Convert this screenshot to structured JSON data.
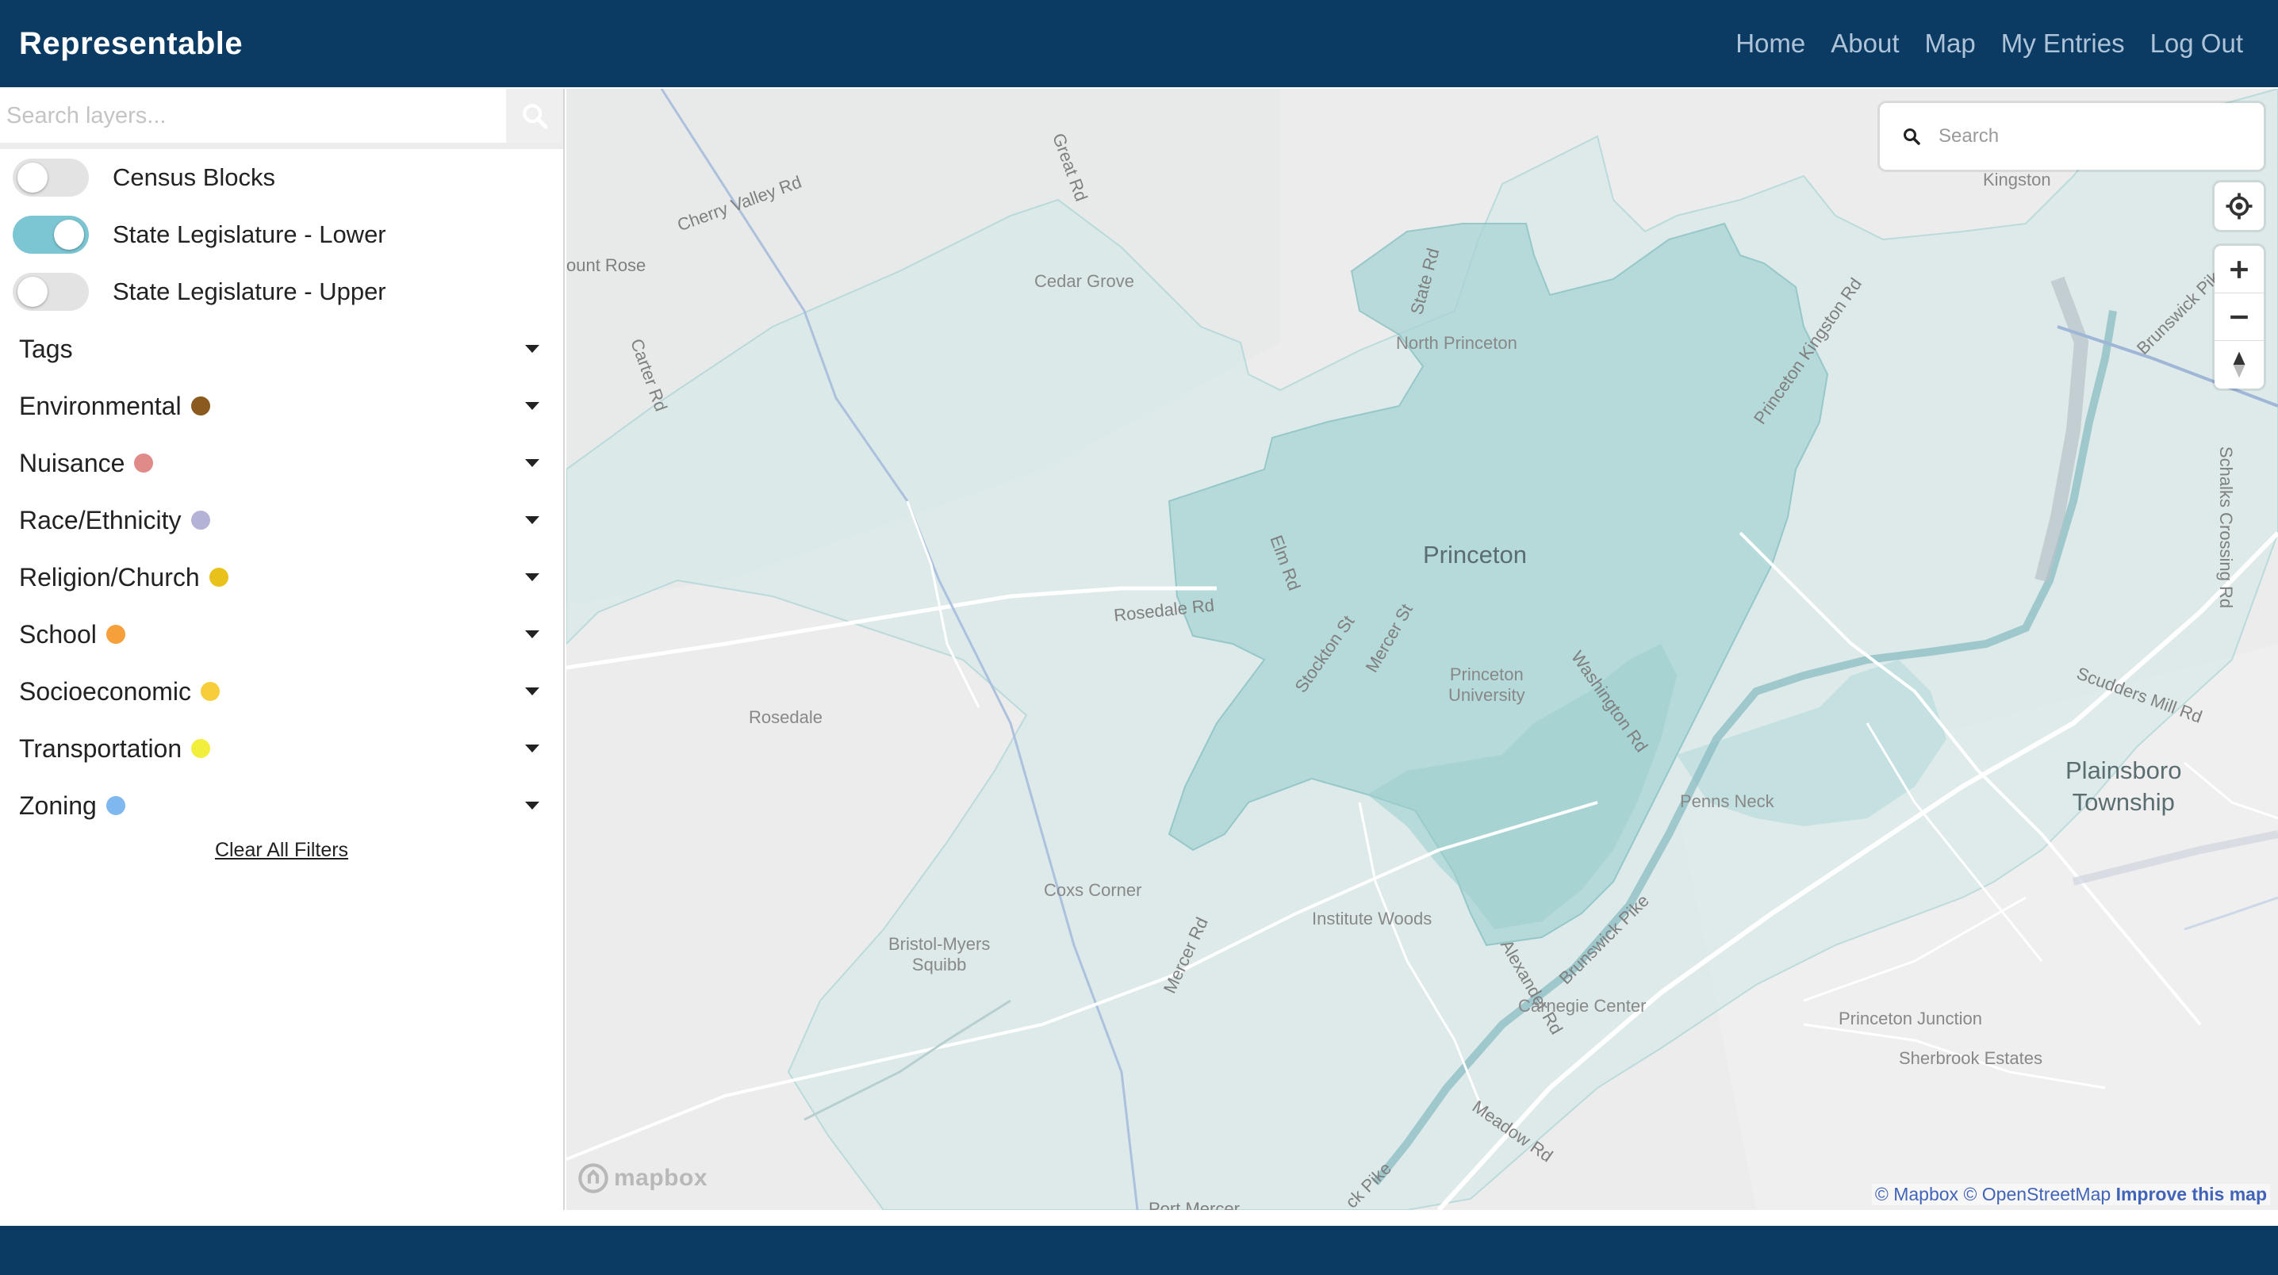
{
  "app": {
    "brand": "Representable"
  },
  "nav": {
    "links": [
      {
        "label": "Home"
      },
      {
        "label": "About"
      },
      {
        "label": "Map"
      },
      {
        "label": "My Entries"
      },
      {
        "label": "Log Out"
      }
    ]
  },
  "sidebar": {
    "search_placeholder": "Search layers...",
    "layers": [
      {
        "label": "Census Blocks",
        "enabled": false
      },
      {
        "label": "State Legislature - Lower",
        "enabled": true
      },
      {
        "label": "State Legislature - Upper",
        "enabled": false
      }
    ],
    "tags_label": "Tags",
    "filters": [
      {
        "label": "Environmental",
        "color": "#8b5a1e"
      },
      {
        "label": "Nuisance",
        "color": "#e08a8a"
      },
      {
        "label": "Race/Ethnicity",
        "color": "#b4b2d6"
      },
      {
        "label": "Religion/Church",
        "color": "#e8c21a"
      },
      {
        "label": "School",
        "color": "#f5a03a"
      },
      {
        "label": "Socioeconomic",
        "color": "#f7cd3c"
      },
      {
        "label": "Transportation",
        "color": "#f2ef3c"
      },
      {
        "label": "Zoning",
        "color": "#7fb8ef"
      }
    ],
    "clear_label": "Clear All Filters"
  },
  "map": {
    "search_placeholder": "Search",
    "labels": {
      "cherry_valley": "Cherry Valley Rd",
      "great_rd": "Great Rd",
      "mount_rose": "ount Rose",
      "cedar_grove": "Cedar Grove",
      "carter_rd": "Carter Rd",
      "state_rd": "State Rd",
      "north_princeton": "North Princeton",
      "kingston": "Kingston",
      "princeton_kingston": "Princeton Kingston Rd",
      "brunswick_pike_top": "Brunswick Pik",
      "schalks": "Schalks Crossing Rd",
      "princeton": "Princeton",
      "elm_rd": "Elm Rd",
      "rosedale_rd": "Rosedale Rd",
      "stockton": "Stockton St",
      "mercer_st": "Mercer St",
      "princeton_university": "Princeton\nUniversity",
      "washington_rd": "Washington Rd",
      "scudders": "Scudders Mill Rd",
      "plainsboro": "Plainsboro\nTownship",
      "rosedale": "Rosedale",
      "penns_neck": "Penns Neck",
      "coxs_corner": "Coxs Corner",
      "institute_woods": "Institute Woods",
      "bristol_myers": "Bristol-Myers\nSquibb",
      "mercer_rd": "Mercer Rd",
      "brunswick_pike": "Brunswick Pike",
      "alexander_rd": "Alexander Rd",
      "carnegie_center": "Carnegie Center",
      "princeton_junction": "Princeton Junction",
      "sherbrook": "Sherbrook Estates",
      "meadow_rd": "Meadow Rd",
      "ck_pike": "ck Pike",
      "port_mercer": "Port Mercer"
    },
    "logo_text": "mapbox",
    "attribution": {
      "mapbox": "© Mapbox",
      "osm": "© OpenStreetMap",
      "improve": "Improve this map"
    },
    "district_color": "#8cc7c7"
  }
}
